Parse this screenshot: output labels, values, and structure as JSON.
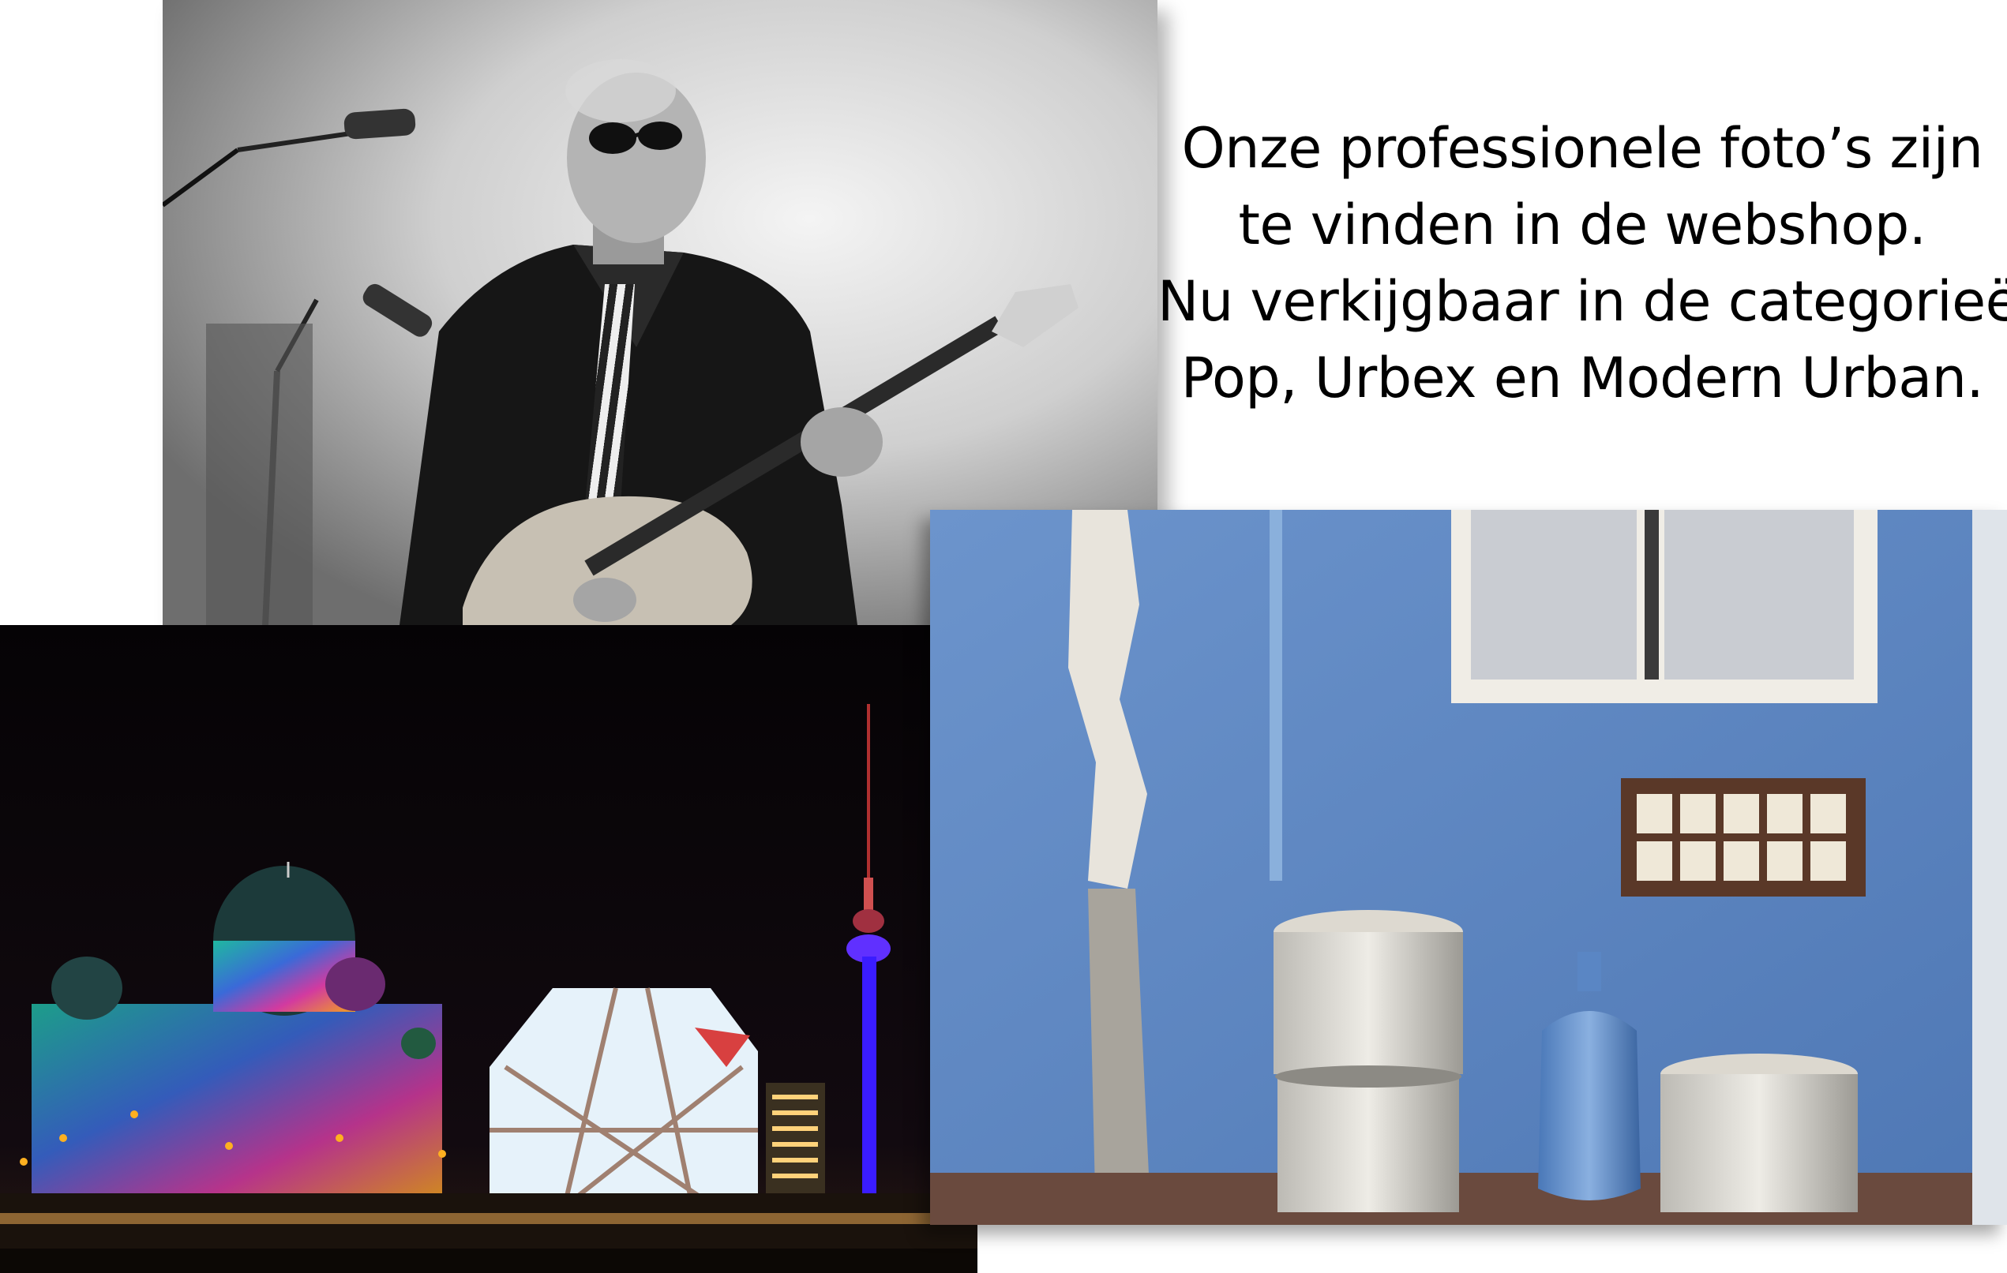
{
  "promo": {
    "lines": [
      "Onze professionele foto’s zijn",
      "te vinden in de webshop.",
      "Nu verkijgbaar in de categorieën",
      "Pop, Urbex en Modern Urban."
    ]
  },
  "photos": {
    "musician": {
      "subject": "bass-player-on-stage",
      "style": "black-and-white"
    },
    "berlin": {
      "subject": "berlin-night-skyline",
      "colors": [
        "#0a0507",
        "#3a1cff",
        "#e0f0ff",
        "#ffb020"
      ]
    },
    "urbex": {
      "subject": "peeling-blue-wall-with-pots",
      "colors": [
        "#5c86c4",
        "#e9e6df",
        "#8a8f96"
      ]
    }
  }
}
